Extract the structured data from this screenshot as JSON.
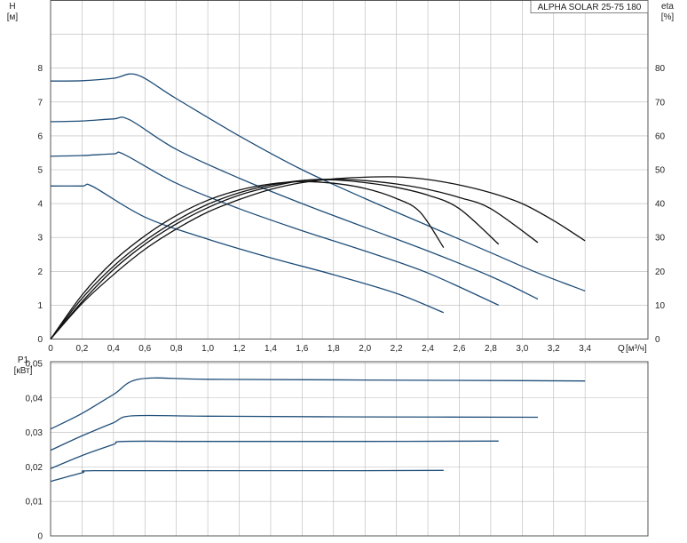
{
  "chart_data": [
    {
      "type": "line",
      "panel": "head-efficiency",
      "title": "ALPHA SOLAR 25-75  180",
      "ylabel": "H",
      "yunit": "[м]",
      "y2label": "eta",
      "y2unit": "[%]",
      "xlabel": "Q",
      "xunit": "[м³/ч]",
      "xlim": [
        0,
        3.8
      ],
      "ylim": [
        0,
        10
      ],
      "y2lim": [
        0,
        100
      ],
      "x_ticks": [
        "0",
        "0,2",
        "0,4",
        "0,6",
        "0,8",
        "1,0",
        "1,2",
        "1,4",
        "1,6",
        "1,8",
        "2,0",
        "2,2",
        "2,4",
        "2,6",
        "2,8",
        "3,0",
        "3,2",
        "3,4"
      ],
      "y_ticks": [
        "0",
        "1",
        "2",
        "3",
        "4",
        "5",
        "6",
        "7",
        "8"
      ],
      "y2_ticks": [
        "0",
        "10",
        "20",
        "30",
        "40",
        "50",
        "60",
        "70",
        "80"
      ],
      "grid": true,
      "colors": {
        "head": "#1f4e79",
        "efficiency": "#111111"
      },
      "series": [
        {
          "axis": "left",
          "x": [
            0,
            0.2,
            0.4,
            0.55,
            0.8,
            1.2,
            1.6,
            2.0,
            2.4,
            2.8,
            3.1,
            3.4
          ],
          "values": [
            7.62,
            7.63,
            7.7,
            7.8,
            7.1,
            6.0,
            5.0,
            4.15,
            3.35,
            2.55,
            1.95,
            1.42
          ]
        },
        {
          "axis": "left",
          "x": [
            0,
            0.2,
            0.4,
            0.5,
            0.8,
            1.2,
            1.6,
            2.0,
            2.4,
            2.8,
            3.1
          ],
          "values": [
            6.42,
            6.44,
            6.5,
            6.48,
            5.6,
            4.75,
            4.0,
            3.3,
            2.6,
            1.85,
            1.18
          ]
        },
        {
          "axis": "left",
          "x": [
            0,
            0.2,
            0.4,
            0.47,
            0.8,
            1.2,
            1.6,
            2.0,
            2.4,
            2.85
          ],
          "values": [
            5.4,
            5.42,
            5.47,
            5.45,
            4.6,
            3.85,
            3.2,
            2.6,
            1.95,
            1.0
          ]
        },
        {
          "axis": "left",
          "x": [
            0,
            0.2,
            0.27,
            0.6,
            1.0,
            1.4,
            1.8,
            2.2,
            2.5
          ],
          "values": [
            4.52,
            4.52,
            4.5,
            3.6,
            2.95,
            2.4,
            1.9,
            1.35,
            0.78
          ]
        },
        {
          "axis": "right",
          "x": [
            0,
            0.2,
            0.4,
            0.6,
            0.8,
            1.0,
            1.2,
            1.4,
            1.6,
            1.8,
            2.0,
            2.2,
            2.4,
            2.6,
            2.8,
            3.0,
            3.2,
            3.4
          ],
          "values": [
            0,
            10.5,
            19,
            26.5,
            32.5,
            37.5,
            41.2,
            44.2,
            46.2,
            47.3,
            47.8,
            47.9,
            47.1,
            45.5,
            43.2,
            40,
            35,
            29
          ]
        },
        {
          "axis": "right",
          "x": [
            0,
            0.2,
            0.4,
            0.6,
            0.8,
            1.0,
            1.2,
            1.4,
            1.6,
            1.8,
            2.0,
            2.2,
            2.4,
            2.6,
            2.8,
            3.1
          ],
          "values": [
            0,
            11,
            20.5,
            28,
            34,
            38.8,
            42.5,
            45,
            46.8,
            47.2,
            46.8,
            45.8,
            44.2,
            41.8,
            38.5,
            28.5
          ]
        },
        {
          "axis": "right",
          "x": [
            0,
            0.2,
            0.4,
            0.6,
            0.8,
            1.0,
            1.2,
            1.4,
            1.6,
            1.8,
            2.0,
            2.2,
            2.4,
            2.6,
            2.85
          ],
          "values": [
            0,
            12,
            21.5,
            29,
            35,
            39.8,
            43.2,
            45.5,
            46.8,
            47,
            46.2,
            44.8,
            42.5,
            38.5,
            28
          ]
        },
        {
          "axis": "right",
          "x": [
            0,
            0.2,
            0.4,
            0.6,
            0.8,
            1.0,
            1.2,
            1.4,
            1.6,
            1.8,
            2.0,
            2.2,
            2.35,
            2.5
          ],
          "values": [
            0,
            13,
            23,
            30.5,
            36.5,
            41,
            44,
            45.8,
            46.5,
            46,
            44.5,
            41.5,
            37.5,
            27
          ]
        }
      ]
    },
    {
      "type": "line",
      "panel": "power",
      "ylabel": "P1",
      "yunit": "[кВт]",
      "xlim": [
        0,
        3.8
      ],
      "ylim": [
        0,
        0.0505
      ],
      "y_ticks": [
        "0",
        "0,01",
        "0,02",
        "0,03",
        "0,04",
        "0,05"
      ],
      "grid": true,
      "colors": {
        "power": "#1f4e79"
      },
      "series": [
        {
          "x": [
            0,
            0.2,
            0.4,
            0.57,
            1.0,
            2.0,
            3.0,
            3.4
          ],
          "values": [
            0.031,
            0.0355,
            0.041,
            0.0455,
            0.0454,
            0.0452,
            0.045,
            0.0449
          ]
        },
        {
          "x": [
            0,
            0.2,
            0.4,
            0.52,
            1.0,
            2.0,
            3.1
          ],
          "values": [
            0.0248,
            0.029,
            0.0328,
            0.0348,
            0.0347,
            0.0345,
            0.0344
          ]
        },
        {
          "x": [
            0,
            0.2,
            0.4,
            0.47,
            1.0,
            2.0,
            2.85
          ],
          "values": [
            0.0195,
            0.0233,
            0.0265,
            0.0274,
            0.0274,
            0.0274,
            0.0275
          ]
        },
        {
          "x": [
            0,
            0.2,
            0.27,
            1.0,
            2.0,
            2.5
          ],
          "values": [
            0.0158,
            0.0183,
            0.0189,
            0.0189,
            0.0189,
            0.019
          ]
        }
      ]
    }
  ]
}
